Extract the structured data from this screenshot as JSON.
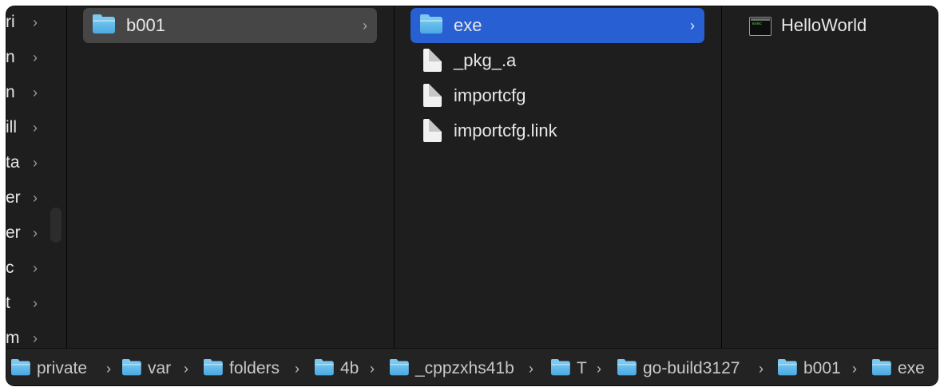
{
  "sidebar": {
    "items": [
      {
        "label": "ri"
      },
      {
        "label": "n"
      },
      {
        "label": "n"
      },
      {
        "label": "ill"
      },
      {
        "label": "ta"
      },
      {
        "label": "er"
      },
      {
        "label": "er"
      },
      {
        "label": "c"
      },
      {
        "label": "t"
      },
      {
        "label": "m"
      }
    ],
    "chevron": "›"
  },
  "column1": {
    "items": [
      {
        "label": "b001",
        "icon": "folder-icon",
        "has_children": true,
        "selected": "inactive"
      }
    ]
  },
  "column2": {
    "items": [
      {
        "label": "exe",
        "icon": "folder-icon",
        "has_children": true,
        "selected": "active"
      },
      {
        "label": "_pkg_.a",
        "icon": "document-icon"
      },
      {
        "label": "importcfg",
        "icon": "document-icon"
      },
      {
        "label": "importcfg.link",
        "icon": "document-icon"
      }
    ]
  },
  "column3": {
    "items": [
      {
        "label": "HelloWorld",
        "icon": "executable-icon"
      }
    ]
  },
  "pathbar": {
    "crumbs": [
      {
        "label": "private"
      },
      {
        "label": "var"
      },
      {
        "label": "folders"
      },
      {
        "label": "4b"
      },
      {
        "label": "_cppzxhs41b"
      },
      {
        "label": "T"
      },
      {
        "label": "go-build3127"
      },
      {
        "label": "b001"
      },
      {
        "label": "exe"
      }
    ],
    "separator": "›"
  },
  "colors": {
    "window_bg": "#1e1e1e",
    "selection_active": "#2860d3",
    "selection_inactive": "#464646",
    "folder_blue": "#5fb8ea"
  }
}
